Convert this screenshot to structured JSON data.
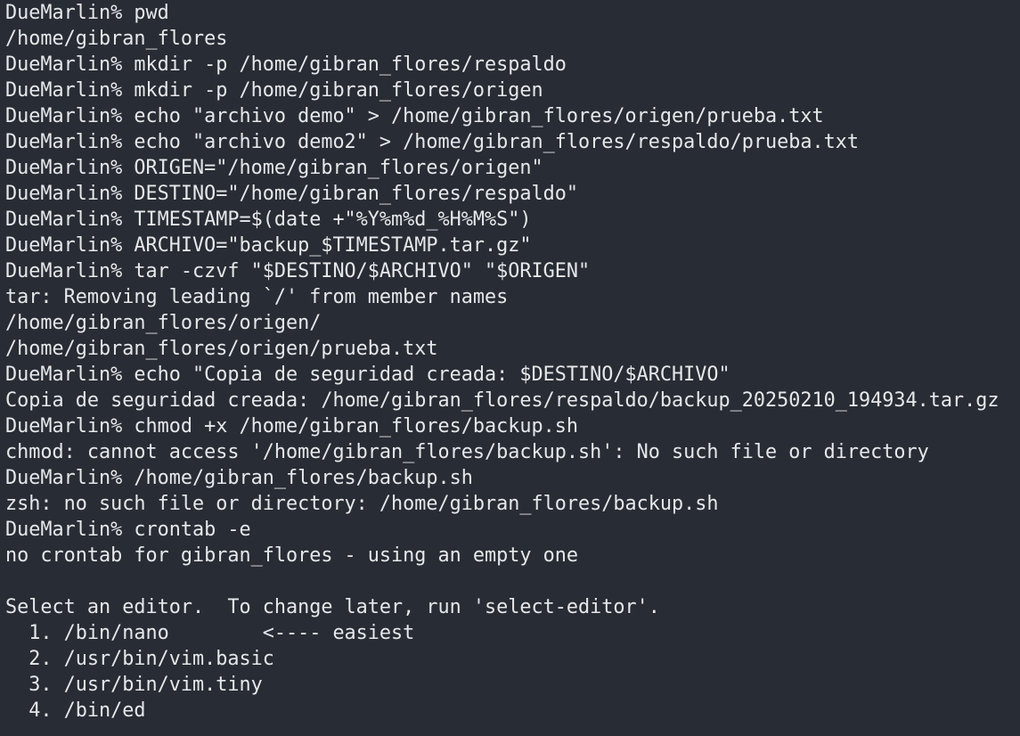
{
  "terminal": {
    "background": "#282c34",
    "foreground": "#e6e8ea",
    "lines": [
      "DueMarlin% pwd",
      "/home/gibran_flores",
      "DueMarlin% mkdir -p /home/gibran_flores/respaldo",
      "DueMarlin% mkdir -p /home/gibran_flores/origen",
      "DueMarlin% echo \"archivo demo\" > /home/gibran_flores/origen/prueba.txt",
      "DueMarlin% echo \"archivo demo2\" > /home/gibran_flores/respaldo/prueba.txt",
      "DueMarlin% ORIGEN=\"/home/gibran_flores/origen\"",
      "DueMarlin% DESTINO=\"/home/gibran_flores/respaldo\"",
      "DueMarlin% TIMESTAMP=$(date +\"%Y%m%d_%H%M%S\")",
      "DueMarlin% ARCHIVO=\"backup_$TIMESTAMP.tar.gz\"",
      "DueMarlin% tar -czvf \"$DESTINO/$ARCHIVO\" \"$ORIGEN\"",
      "tar: Removing leading `/' from member names",
      "/home/gibran_flores/origen/",
      "/home/gibran_flores/origen/prueba.txt",
      "DueMarlin% echo \"Copia de seguridad creada: $DESTINO/$ARCHIVO\"",
      "Copia de seguridad creada: /home/gibran_flores/respaldo/backup_20250210_194934.tar.gz",
      "DueMarlin% chmod +x /home/gibran_flores/backup.sh",
      "chmod: cannot access '/home/gibran_flores/backup.sh': No such file or directory",
      "DueMarlin% /home/gibran_flores/backup.sh",
      "zsh: no such file or directory: /home/gibran_flores/backup.sh",
      "DueMarlin% crontab -e",
      "no crontab for gibran_flores - using an empty one",
      "",
      "Select an editor.  To change later, run 'select-editor'.",
      "  1. /bin/nano        <---- easiest",
      "  2. /usr/bin/vim.basic",
      "  3. /usr/bin/vim.tiny",
      "  4. /bin/ed"
    ]
  }
}
